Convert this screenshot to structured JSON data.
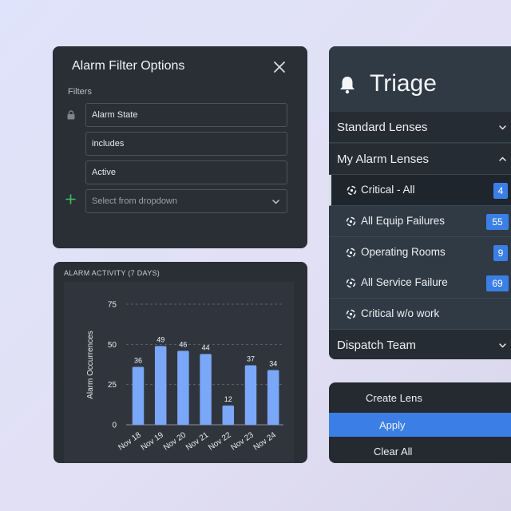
{
  "filter_panel": {
    "title": "Alarm Filter Options",
    "filters_label": "Filters",
    "fields": [
      "Alarm State",
      "includes",
      "Active"
    ],
    "dropdown_placeholder": "Select from dropdown",
    "icons": {
      "lock": "lock-icon",
      "add": "plus-icon",
      "close": "close-icon"
    }
  },
  "chart_panel": {
    "title": "ALARM ACTIVITY (7 DAYS)"
  },
  "chart_data": {
    "type": "bar",
    "title": "ALARM ACTIVITY (7 DAYS)",
    "categories": [
      "Nov 18",
      "Nov 19",
      "Nov 20",
      "Nov 21",
      "Nov 22",
      "Nov 23",
      "Nov 24"
    ],
    "values": [
      36,
      49,
      46,
      44,
      12,
      37,
      34
    ],
    "xlabel": "",
    "ylabel": "Alarm Occurrences",
    "ylim": [
      0,
      75
    ],
    "yticks": [
      0,
      25,
      50,
      75
    ],
    "grid": true,
    "bar_color": "#7aa7f7"
  },
  "triage": {
    "title": "Triage",
    "sections": {
      "standard": "Standard Lenses",
      "my": "My Alarm Lenses",
      "dispatch": "Dispatch Team"
    },
    "lenses": [
      {
        "label": "Critical - All",
        "count": "4",
        "active": true
      },
      {
        "label": "All Equip Failures",
        "count": "55"
      },
      {
        "label": "Operating Rooms",
        "count": "9"
      },
      {
        "label": "All Service Failure",
        "count": "69"
      },
      {
        "label": "Critical w/o work",
        "count": ""
      }
    ],
    "accent": "#3b7fe6"
  },
  "actions": {
    "create": "Create Lens",
    "apply": "Apply",
    "clear": "Clear All"
  }
}
